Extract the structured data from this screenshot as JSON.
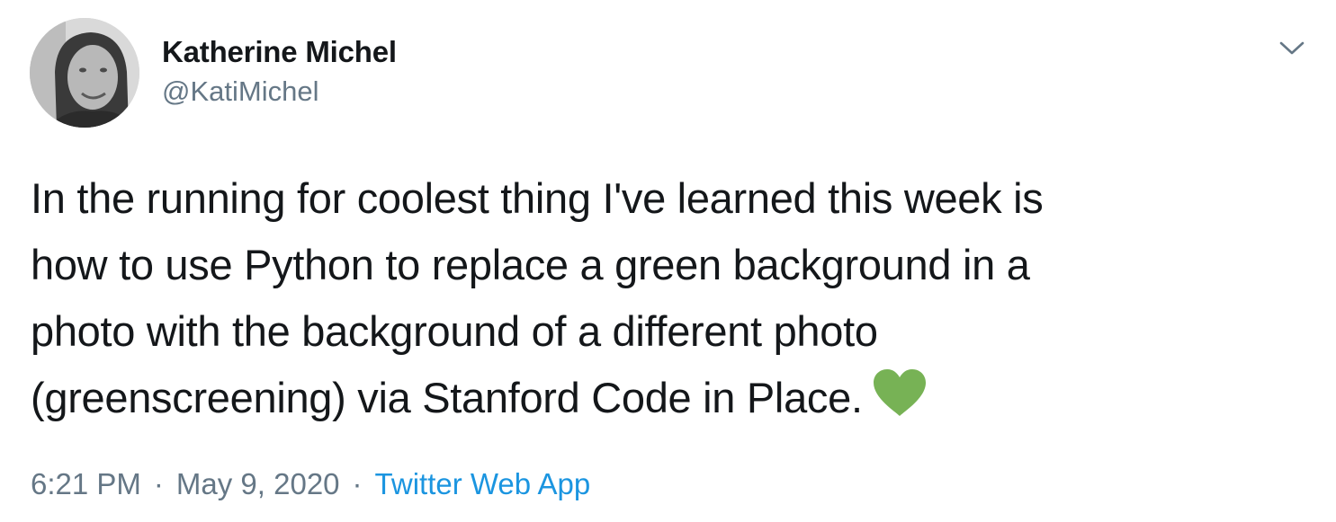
{
  "tweet": {
    "author": {
      "display_name": "Katherine Michel",
      "handle": "@KatiMichel",
      "avatar_icon": "profile-photo"
    },
    "menu_icon": "chevron-down-icon",
    "text_lines": [
      "In the running for coolest thing I've learned this week is",
      "how to use Python to replace a green background in a",
      "photo with the background of a different photo",
      "(greenscreening) via Stanford Code in Place."
    ],
    "emoji": {
      "name": "green-heart-icon",
      "color": "#77b255"
    },
    "meta": {
      "time": "6:21 PM",
      "separator": "·",
      "date": "May 9, 2020",
      "source": "Twitter Web App"
    }
  },
  "colors": {
    "text": "#14171a",
    "secondary": "#657786",
    "link": "#1b95e0"
  }
}
